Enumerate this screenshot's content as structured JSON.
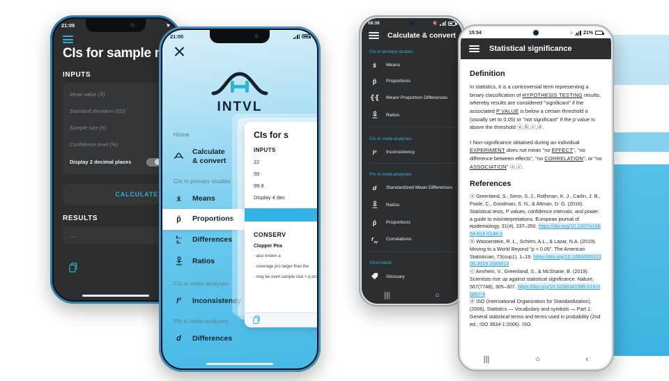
{
  "background": {
    "accent_blue": "#4BB4E2",
    "light_blue": "#C9E9F6",
    "mid_blue": "#85D1EE"
  },
  "phone1": {
    "status": {
      "time": "21:09",
      "location_icon": "location-arrow-icon"
    },
    "menu_icon": "hamburger-menu-icon",
    "title": "CIs for sample m",
    "section_inputs": "INPUTS",
    "inputs": [
      "Mean value (X̄)",
      "Standard deviation (SD)",
      "Sample size (n)",
      "Confidence level (%)"
    ],
    "decimal_row": "Display 2 decimal places",
    "calculate_label": "CALCULATE",
    "section_results": "RESULTS",
    "results_value": "...",
    "copy_icon": "copy-document-icon"
  },
  "phone2": {
    "status": {
      "time": "21:05",
      "location_icon": "location-arrow-icon"
    },
    "close_icon": "close-x-icon",
    "brand": "INTVL",
    "logo_icon": "bell-curve-interval-logo",
    "nav": [
      {
        "type": "header",
        "label": "Home"
      },
      {
        "type": "item",
        "glyph": "bell-curve-icon",
        "icon_char": "◠",
        "label": "Calculate\n& convert",
        "active": false
      },
      {
        "type": "header",
        "label": "CIs in primary studies"
      },
      {
        "type": "item",
        "glyph": "x-bar-icon",
        "icon_char": "x̄",
        "label": "Means",
        "active": false
      },
      {
        "type": "item",
        "glyph": "p-hat-icon",
        "icon_char": "p̂",
        "label": "Proportions",
        "active": true
      },
      {
        "type": "item",
        "glyph": "x-minus-x-icon",
        "icon_char": "x₁-x₂",
        "label": "Differences",
        "active": false
      },
      {
        "type": "item",
        "glyph": "ratio-icon",
        "icon_char": "⚯",
        "label": "Ratios",
        "active": false
      },
      {
        "type": "header",
        "label": "CIs in meta-analyses"
      },
      {
        "type": "item",
        "glyph": "i-squared-icon",
        "icon_char": "I²",
        "label": "Inconsistency",
        "active": false
      },
      {
        "type": "header",
        "label": "PIs in meta-analyses"
      },
      {
        "type": "item",
        "glyph": "d-icon",
        "icon_char": "d",
        "label": "Differences",
        "active": false
      }
    ],
    "card": {
      "title": "CIs for s",
      "section": "INPUTS",
      "values": [
        "22",
        "55",
        "99.9",
        "Display 4 dec"
      ],
      "button_label": "",
      "heading": "CONSERV",
      "subheading": "Clopper Pea",
      "bullets": [
        "- also known a",
        "- coverage pro\nlarger than the",
        "- may be overl\nsample size × p\nproportion)"
      ],
      "footer_icon": "copy-document-icon"
    }
  },
  "phone3": {
    "status": {
      "time": "08:38",
      "battery": "",
      "icons": "mute-wifi-signal-battery"
    },
    "menu_icon": "hamburger-menu-icon",
    "title": "Calculate & convert",
    "sections": [
      {
        "header": "CIs in primary studies",
        "items": [
          {
            "glyph": "x-bar-icon",
            "icon_char": "x̄",
            "label": "Means"
          },
          {
            "glyph": "p-hat-icon",
            "icon_char": "p̂",
            "label": "Proportions"
          },
          {
            "glyph": "mean-diff-icon",
            "icon_char": "{{",
            "label": "Mean/ Proportion Differences"
          },
          {
            "glyph": "ratio-icon",
            "icon_char": "⚯",
            "label": "Ratios"
          }
        ]
      },
      {
        "header": "CIs in meta-analyses",
        "items": [
          {
            "glyph": "i-squared-icon",
            "icon_char": "I²",
            "label": "Inconsistency"
          }
        ]
      },
      {
        "header": "PIs in meta-analyses",
        "items": [
          {
            "glyph": "d-icon",
            "icon_char": "d",
            "label": "Standardized Mean Differences"
          },
          {
            "glyph": "ratio-icon",
            "icon_char": "⚯",
            "label": "Ratios"
          },
          {
            "glyph": "p-hat-icon",
            "icon_char": "p̂",
            "label": "Proportions"
          },
          {
            "glyph": "r-xy-icon",
            "icon_char": "r",
            "label": "Correlations"
          }
        ]
      },
      {
        "header": "Information",
        "items": [
          {
            "glyph": "tag-icon",
            "icon_char": "◆",
            "label": "Glossary"
          }
        ]
      }
    ],
    "nav": {
      "recents": "|||",
      "home": "○",
      "back": ""
    }
  },
  "phone4": {
    "status": {
      "time": "15:54",
      "battery_percent": "21%",
      "icons": "home-wifi-signal-battery"
    },
    "menu_icon": "hamburger-menu-icon",
    "title": "Statistical significance",
    "definition_heading": "Definition",
    "definition_body_1": "In statistics, it is a controversial term representing a binary classification of ",
    "definition_link_1": "HYPOTHESIS TESTING",
    "definition_body_2": " results, whereby results are considered \"significant\" if the associated ",
    "definition_link_2": "P VALUE",
    "definition_body_3": " is below a certain threshold α (usually set to 0.05) or \"not significant\" if the ",
    "definition_italic": "p",
    "definition_body_4": " value is above the threshold ⓐ,ⓑ,ⓒ,ⓓ.",
    "warning_bang": "!",
    "warning_body_1": " Non-significance obtained during an individual ",
    "warning_link_1": "EXPERIMENT",
    "warning_body_2": " does not mean \"no ",
    "warning_link_2": "EFFECT",
    "warning_body_3": "\", \"no difference between effects\", \"no ",
    "warning_link_3": "CORRELATION",
    "warning_body_4": "\", or \"no ",
    "warning_link_4": "ASSOCIATION",
    "warning_body_5": "\" ⓐ,ⓒ.",
    "references_heading": "References",
    "references": [
      {
        "marker": "ⓐ",
        "text": " Greenland, S., Senn, S. J., Rothman, K. J., Carlin, J. B., Poole, C., Goodman, S. N., & Altman, D. G. (2016). Statistical tests, P values, confidence intervals, and power: a guide to misinterpretations. European journal of epidemiology, 31(4), 337–350.",
        "link": "https://doi.org/10.1007/s10654-016-0149-3"
      },
      {
        "marker": "ⓑ",
        "text": " Wasserstein, R. L., Schirm, A.L., & Lazar, N.A. (2019). Moving to a World Beyond \"p < 0.05\". The American Statistician, 73(sup1), 1–19.",
        "link": "https://doi.org/10.1080/00031305.2019.1583913"
      },
      {
        "marker": "ⓒ",
        "text": " Amrhein, V., Greenland, S., & McShane, B. (2019). Scientists rise up against statistical significance. Nature, 567(7748), 305–307.",
        "link": "https://doi.org/10.1038/d41586-019-00857-9"
      },
      {
        "marker": "ⓓ",
        "text": " ISO (International Organization for Standardization). (2006). Statistics — Vocabulary and symbols — Part 1: General statistical terms and terms used in probability (2nd ed.; ISO 3534-1:2006). ISO.",
        "link": ""
      }
    ],
    "nav": {
      "recents": "|||",
      "home": "○",
      "back": "‹"
    }
  }
}
